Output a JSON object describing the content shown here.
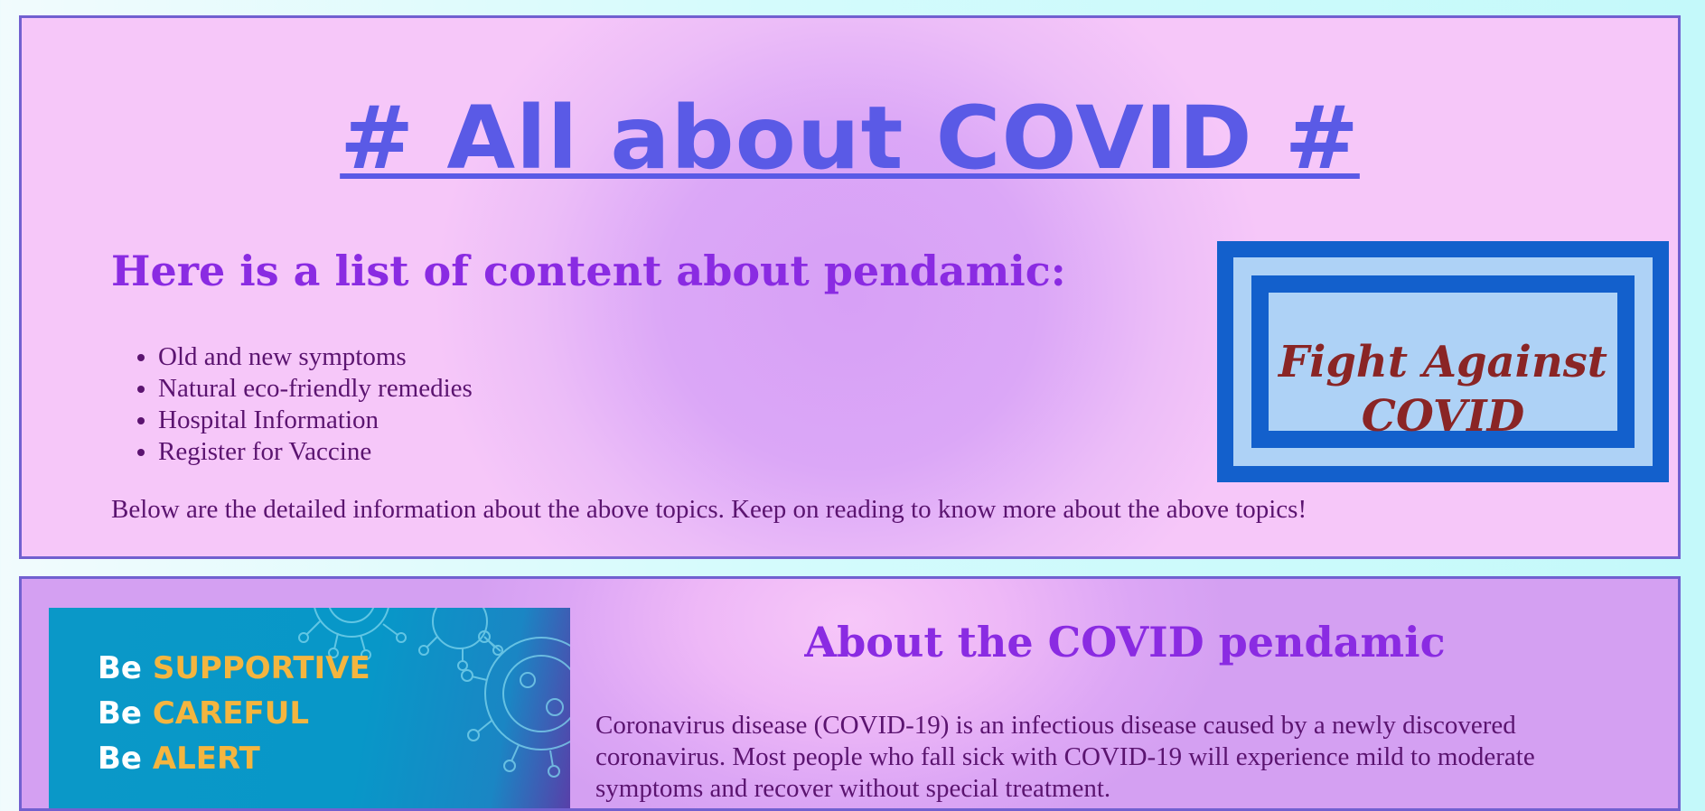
{
  "header": {
    "title": "# All about COVID #",
    "list_heading": "Here is a list of content about pendamic:",
    "topics": [
      "Old and new symptoms",
      "Natural eco-friendly remedies",
      "Hospital Information",
      "Register for Vaccine"
    ],
    "intro_paragraph": "Below are the detailed information about the above topics. Keep on reading to know more about the above topics!",
    "banner": {
      "text": "Fight Against COVID"
    }
  },
  "about": {
    "image_lines": [
      {
        "prefix": "Be",
        "word": "SUPPORTIVE"
      },
      {
        "prefix": "Be",
        "word": "CAREFUL"
      },
      {
        "prefix": "Be",
        "word": "ALERT"
      }
    ],
    "heading": "About the COVID pendamic",
    "paragraph": "Coronavirus disease (COVID-19) is an infectious disease caused by a newly discovered coronavirus. Most people who fall sick with COVID-19 will experience mild to moderate symptoms and recover without special treatment."
  },
  "colors": {
    "title": "#5a5ae6",
    "heading": "#8a2be2",
    "body_text": "#5b1470",
    "section_border": "#7160d0",
    "banner_blue": "#1360cc",
    "banner_fill": "#aed2f6",
    "banner_text": "#8a2525",
    "image_accent": "#f4b53f"
  }
}
